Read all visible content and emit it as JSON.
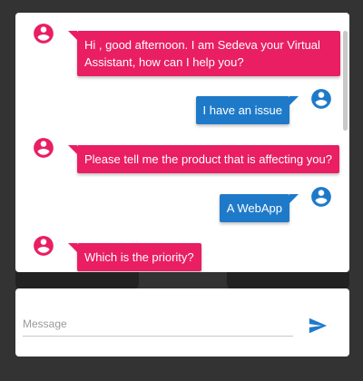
{
  "colors": {
    "background": "#333333",
    "bot_bubble": "#e91e63",
    "user_bubble": "#1e7ac9",
    "send_icon": "#1e7ac9"
  },
  "messages": [
    {
      "sender": "bot",
      "avatar_icon": "account-circle-icon",
      "text": "Hi , good afternoon. I am Sedeva your Virtual Assistant, how can I help you?"
    },
    {
      "sender": "user",
      "avatar_icon": "account-circle-icon",
      "text": "I have an issue"
    },
    {
      "sender": "bot",
      "avatar_icon": "account-circle-icon",
      "text": "Please tell me the product that is affecting you?"
    },
    {
      "sender": "user",
      "avatar_icon": "account-circle-icon",
      "text": "A WebApp"
    },
    {
      "sender": "bot",
      "avatar_icon": "account-circle-icon",
      "text": "Which is the priority?"
    }
  ],
  "composer": {
    "placeholder": "Message",
    "value": "",
    "send_icon": "send-icon"
  }
}
